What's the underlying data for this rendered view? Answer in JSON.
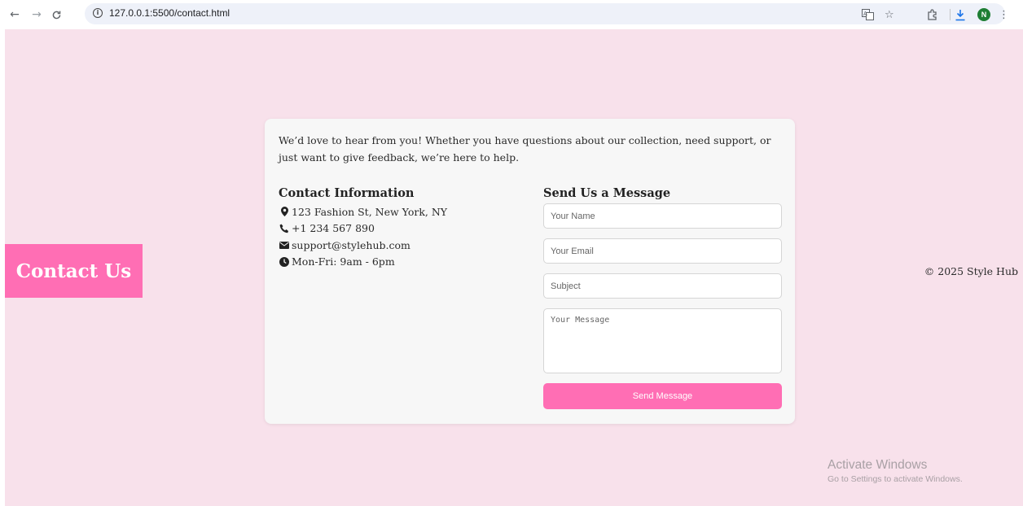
{
  "browser": {
    "back_icon": "←",
    "forward_icon": "→",
    "reload_icon": "C",
    "url": "127.0.0.1:5500/contact.html",
    "avatar_letter": "N"
  },
  "page": {
    "badge": "Contact Us",
    "intro": "We’d love to hear from you! Whether you have questions about our collection, need support, or just want to give feedback, we’re here to help.",
    "contact_info": {
      "title": "Contact Information",
      "address": "123 Fashion St, New York, NY",
      "phone": "+1 234 567 890",
      "email": "support@stylehub.com",
      "hours": "Mon-Fri: 9am - 6pm"
    },
    "form": {
      "title": "Send Us a Message",
      "name_placeholder": "Your Name",
      "email_placeholder": "Your Email",
      "subject_placeholder": "Subject",
      "message_placeholder": "Your Message",
      "submit_label": "Send Message"
    },
    "footer": "© 2025 Style Hub"
  },
  "watermark": {
    "line1": "Activate Windows",
    "line2": "Go to Settings to activate Windows."
  },
  "colors": {
    "page_bg": "#f8e1eb",
    "accent": "#ff6eb4",
    "card_bg": "#f7f7f7"
  }
}
